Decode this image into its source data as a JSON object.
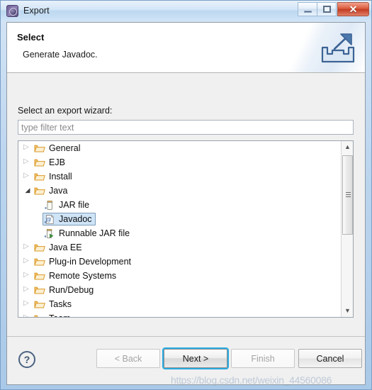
{
  "window": {
    "title": "Export",
    "icon": "eclipse-export-gear-icon",
    "minimize_label": "–",
    "maximize_label": "□",
    "close_label": "✕"
  },
  "banner": {
    "title": "Select",
    "subtitle": "Generate Javadoc.",
    "icon": "export-tray-arrow-icon"
  },
  "body": {
    "wizard_label": "Select an export wizard:",
    "filter": {
      "value": "",
      "placeholder": "type filter text"
    }
  },
  "tree": {
    "items": [
      {
        "label": "General",
        "level": 1,
        "state": "collapsed",
        "icon": "folder-icon",
        "selected": false
      },
      {
        "label": "EJB",
        "level": 1,
        "state": "collapsed",
        "icon": "folder-icon",
        "selected": false
      },
      {
        "label": "Install",
        "level": 1,
        "state": "collapsed",
        "icon": "folder-icon",
        "selected": false
      },
      {
        "label": "Java",
        "level": 1,
        "state": "expanded",
        "icon": "folder-icon",
        "selected": false
      },
      {
        "label": "JAR file",
        "level": 2,
        "state": "leaf",
        "icon": "jar-file-icon",
        "selected": false
      },
      {
        "label": "Javadoc",
        "level": 2,
        "state": "leaf",
        "icon": "javadoc-icon",
        "selected": true
      },
      {
        "label": "Runnable JAR file",
        "level": 2,
        "state": "leaf",
        "icon": "runnable-jar-icon",
        "selected": false
      },
      {
        "label": "Java EE",
        "level": 1,
        "state": "collapsed",
        "icon": "folder-icon",
        "selected": false
      },
      {
        "label": "Plug-in Development",
        "level": 1,
        "state": "collapsed",
        "icon": "folder-icon",
        "selected": false
      },
      {
        "label": "Remote Systems",
        "level": 1,
        "state": "collapsed",
        "icon": "folder-icon",
        "selected": false
      },
      {
        "label": "Run/Debug",
        "level": 1,
        "state": "collapsed",
        "icon": "folder-icon",
        "selected": false
      },
      {
        "label": "Tasks",
        "level": 1,
        "state": "collapsed",
        "icon": "folder-icon",
        "selected": false
      },
      {
        "label": "Team",
        "level": 1,
        "state": "collapsed",
        "icon": "folder-icon",
        "selected": false
      }
    ],
    "scrollbar": {
      "up_glyph": "▲",
      "down_glyph": "▼"
    }
  },
  "footer": {
    "help_label": "?",
    "buttons": [
      {
        "label": "< Back",
        "state": "disabled"
      },
      {
        "label": "Next >",
        "state": "default"
      },
      {
        "label": "Finish",
        "state": "disabled"
      },
      {
        "label": "Cancel",
        "state": "normal"
      }
    ]
  },
  "watermark": {
    "text": "https://blog.csdn.net/weixin_44560086"
  },
  "colors": {
    "selection_fill": "#cfe4f7",
    "selection_border": "#7d9db8",
    "focus_ring": "#29abe2",
    "folder": "#e8a33d",
    "title_gradient_top": "#e9f2fb",
    "close_button": "#c23c22"
  }
}
